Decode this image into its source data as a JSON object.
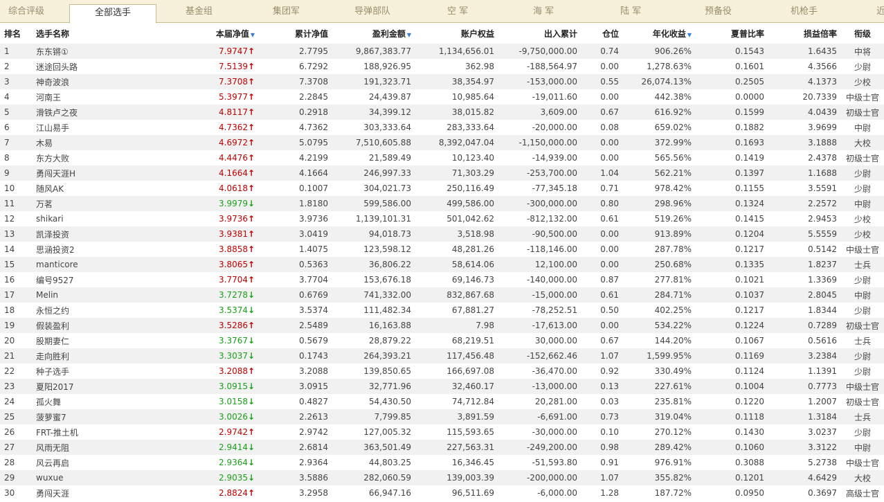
{
  "tabs": [
    {
      "label": "综合评级",
      "active": false
    },
    {
      "label": "全部选手",
      "active": true
    },
    {
      "label": "基金组",
      "active": false
    },
    {
      "label": "集团军",
      "active": false
    },
    {
      "label": "导弹部队",
      "active": false
    },
    {
      "label": "空 军",
      "active": false
    },
    {
      "label": "海 军",
      "active": false
    },
    {
      "label": "陆 军",
      "active": false
    },
    {
      "label": "预备役",
      "active": false
    },
    {
      "label": "机枪手",
      "active": false
    },
    {
      "label": "近",
      "active": false
    }
  ],
  "headers": {
    "rank": "排名",
    "name": "选手名称",
    "nav": "本届净值",
    "cum_nav": "累计净值",
    "profit": "盈利金额",
    "equity": "账户权益",
    "flow": "出入累计",
    "position": "仓位",
    "annual": "年化收益",
    "sharpe": "夏普比率",
    "pl_ratio": "损益倍率",
    "grade": "衔级"
  },
  "colors": {
    "up": "#c00000",
    "down": "#1aa01a",
    "sort_icon": "#3a7bd5"
  },
  "rows": [
    {
      "rank": "1",
      "name": "东东锵①",
      "nav": "7.9747",
      "dir": "up",
      "cum_nav": "2.7795",
      "profit": "9,867,383.77",
      "equity": "1,134,656.01",
      "flow": "-9,750,000.00",
      "position": "0.74",
      "annual": "906.26%",
      "sharpe": "0.1543",
      "pl_ratio": "1.6435",
      "grade": "中将"
    },
    {
      "rank": "2",
      "name": "迷途回头路",
      "nav": "7.5139",
      "dir": "up",
      "cum_nav": "6.7292",
      "profit": "188,926.95",
      "equity": "362.98",
      "flow": "-188,564.97",
      "position": "0.00",
      "annual": "1,278.63%",
      "sharpe": "0.1601",
      "pl_ratio": "4.3566",
      "grade": "少尉"
    },
    {
      "rank": "3",
      "name": "神奇波浪",
      "nav": "7.3708",
      "dir": "up",
      "cum_nav": "7.3708",
      "profit": "191,323.71",
      "equity": "38,354.97",
      "flow": "-153,000.00",
      "position": "0.55",
      "annual": "26,074.13%",
      "sharpe": "0.2505",
      "pl_ratio": "4.1373",
      "grade": "少校"
    },
    {
      "rank": "4",
      "name": "河南王",
      "nav": "5.3977",
      "dir": "up",
      "cum_nav": "2.2845",
      "profit": "24,439.87",
      "equity": "10,985.64",
      "flow": "-19,011.60",
      "position": "0.00",
      "annual": "442.38%",
      "sharpe": "0.0000",
      "pl_ratio": "20.7339",
      "grade": "中级士官"
    },
    {
      "rank": "5",
      "name": "滑铁卢之夜",
      "nav": "4.8117",
      "dir": "up",
      "cum_nav": "0.2918",
      "profit": "34,399.12",
      "equity": "38,015.82",
      "flow": "3,609.00",
      "position": "0.67",
      "annual": "616.92%",
      "sharpe": "0.1599",
      "pl_ratio": "4.0439",
      "grade": "初级士官"
    },
    {
      "rank": "6",
      "name": "江山易手",
      "nav": "4.7362",
      "dir": "up",
      "cum_nav": "4.7362",
      "profit": "303,333.64",
      "equity": "283,333.64",
      "flow": "-20,000.00",
      "position": "0.08",
      "annual": "659.02%",
      "sharpe": "0.1882",
      "pl_ratio": "3.9699",
      "grade": "中尉"
    },
    {
      "rank": "7",
      "name": "木易",
      "nav": "4.6972",
      "dir": "up",
      "cum_nav": "5.0795",
      "profit": "7,510,605.88",
      "equity": "8,392,047.04",
      "flow": "-1,150,000.00",
      "position": "0.00",
      "annual": "372.99%",
      "sharpe": "0.1693",
      "pl_ratio": "3.1888",
      "grade": "大校"
    },
    {
      "rank": "8",
      "name": "东方大败",
      "nav": "4.4476",
      "dir": "up",
      "cum_nav": "4.2199",
      "profit": "21,589.49",
      "equity": "10,123.40",
      "flow": "-14,939.00",
      "position": "0.00",
      "annual": "565.56%",
      "sharpe": "0.1419",
      "pl_ratio": "2.4378",
      "grade": "初级士官"
    },
    {
      "rank": "9",
      "name": "勇闯天涯H",
      "nav": "4.1664",
      "dir": "up",
      "cum_nav": "4.1664",
      "profit": "246,997.33",
      "equity": "71,303.29",
      "flow": "-253,700.00",
      "position": "1.04",
      "annual": "562.21%",
      "sharpe": "0.1397",
      "pl_ratio": "1.1688",
      "grade": "少尉"
    },
    {
      "rank": "10",
      "name": "随风AK",
      "nav": "4.0618",
      "dir": "up",
      "cum_nav": "0.1007",
      "profit": "304,021.73",
      "equity": "250,116.49",
      "flow": "-77,345.18",
      "position": "0.71",
      "annual": "978.42%",
      "sharpe": "0.1155",
      "pl_ratio": "3.5591",
      "grade": "少尉"
    },
    {
      "rank": "11",
      "name": "万茗",
      "nav": "3.9979",
      "dir": "down",
      "cum_nav": "1.8180",
      "profit": "599,586.00",
      "equity": "499,586.00",
      "flow": "-300,000.00",
      "position": "0.80",
      "annual": "298.96%",
      "sharpe": "0.1324",
      "pl_ratio": "2.2572",
      "grade": "中尉"
    },
    {
      "rank": "12",
      "name": "shikari",
      "nav": "3.9736",
      "dir": "up",
      "cum_nav": "3.9736",
      "profit": "1,139,101.31",
      "equity": "501,042.62",
      "flow": "-812,132.00",
      "position": "0.61",
      "annual": "519.26%",
      "sharpe": "0.1415",
      "pl_ratio": "2.9453",
      "grade": "少校"
    },
    {
      "rank": "13",
      "name": "凯泽投资",
      "nav": "3.9381",
      "dir": "up",
      "cum_nav": "3.0419",
      "profit": "94,018.73",
      "equity": "3,518.98",
      "flow": "-90,500.00",
      "position": "0.00",
      "annual": "913.89%",
      "sharpe": "0.1204",
      "pl_ratio": "5.5559",
      "grade": "少校"
    },
    {
      "rank": "14",
      "name": "思涵投资2",
      "nav": "3.8858",
      "dir": "up",
      "cum_nav": "1.4075",
      "profit": "123,598.12",
      "equity": "48,281.26",
      "flow": "-118,146.00",
      "position": "0.00",
      "annual": "287.78%",
      "sharpe": "0.1217",
      "pl_ratio": "0.5142",
      "grade": "中级士官"
    },
    {
      "rank": "15",
      "name": "manticore",
      "nav": "3.8065",
      "dir": "up",
      "cum_nav": "0.5363",
      "profit": "36,806.22",
      "equity": "58,614.06",
      "flow": "12,100.00",
      "position": "0.00",
      "annual": "250.68%",
      "sharpe": "0.1335",
      "pl_ratio": "1.8237",
      "grade": "士兵"
    },
    {
      "rank": "16",
      "name": "编号9527",
      "nav": "3.7704",
      "dir": "up",
      "cum_nav": "3.7704",
      "profit": "153,676.18",
      "equity": "69,146.73",
      "flow": "-140,000.00",
      "position": "0.87",
      "annual": "277.81%",
      "sharpe": "0.1021",
      "pl_ratio": "1.3369",
      "grade": "少尉"
    },
    {
      "rank": "17",
      "name": "Melin",
      "nav": "3.7278",
      "dir": "down",
      "cum_nav": "0.6769",
      "profit": "741,332.00",
      "equity": "832,867.68",
      "flow": "-15,000.00",
      "position": "0.61",
      "annual": "284.71%",
      "sharpe": "0.1037",
      "pl_ratio": "2.8045",
      "grade": "中尉"
    },
    {
      "rank": "18",
      "name": "永恒之约",
      "nav": "3.5374",
      "dir": "down",
      "cum_nav": "3.5374",
      "profit": "111,482.34",
      "equity": "67,881.27",
      "flow": "-78,252.51",
      "position": "0.50",
      "annual": "402.25%",
      "sharpe": "0.1217",
      "pl_ratio": "1.8344",
      "grade": "少尉"
    },
    {
      "rank": "19",
      "name": "假装盈利",
      "nav": "3.5286",
      "dir": "up",
      "cum_nav": "2.5489",
      "profit": "16,163.88",
      "equity": "7.98",
      "flow": "-17,613.00",
      "position": "0.00",
      "annual": "534.22%",
      "sharpe": "0.1224",
      "pl_ratio": "0.7289",
      "grade": "初级士官"
    },
    {
      "rank": "20",
      "name": "股期妻仁",
      "nav": "3.3767",
      "dir": "down",
      "cum_nav": "0.5679",
      "profit": "28,879.22",
      "equity": "68,219.51",
      "flow": "30,000.00",
      "position": "0.67",
      "annual": "144.20%",
      "sharpe": "0.1067",
      "pl_ratio": "0.5616",
      "grade": "士兵"
    },
    {
      "rank": "21",
      "name": "走向胜利",
      "nav": "3.3037",
      "dir": "down",
      "cum_nav": "0.1743",
      "profit": "264,393.21",
      "equity": "117,456.48",
      "flow": "-152,662.46",
      "position": "1.07",
      "annual": "1,599.95%",
      "sharpe": "0.1169",
      "pl_ratio": "3.2384",
      "grade": "少尉"
    },
    {
      "rank": "22",
      "name": "种子选手",
      "nav": "3.2088",
      "dir": "up",
      "cum_nav": "3.2088",
      "profit": "139,850.65",
      "equity": "166,697.08",
      "flow": "-36,470.00",
      "position": "0.92",
      "annual": "330.49%",
      "sharpe": "0.1124",
      "pl_ratio": "1.1391",
      "grade": "少尉"
    },
    {
      "rank": "23",
      "name": "夏阳2017",
      "nav": "3.0915",
      "dir": "down",
      "cum_nav": "3.0915",
      "profit": "32,771.96",
      "equity": "32,460.17",
      "flow": "-13,000.00",
      "position": "0.13",
      "annual": "227.61%",
      "sharpe": "0.1004",
      "pl_ratio": "0.7773",
      "grade": "中级士官"
    },
    {
      "rank": "24",
      "name": "孤火舞",
      "nav": "3.0158",
      "dir": "down",
      "cum_nav": "0.4827",
      "profit": "54,430.50",
      "equity": "74,712.84",
      "flow": "20,281.00",
      "position": "0.03",
      "annual": "235.81%",
      "sharpe": "0.1220",
      "pl_ratio": "1.2007",
      "grade": "初级士官"
    },
    {
      "rank": "25",
      "name": "菠萝蜜7",
      "nav": "3.0026",
      "dir": "down",
      "cum_nav": "2.2613",
      "profit": "7,799.85",
      "equity": "3,891.59",
      "flow": "-6,691.00",
      "position": "0.73",
      "annual": "319.04%",
      "sharpe": "0.1118",
      "pl_ratio": "1.3184",
      "grade": "士兵"
    },
    {
      "rank": "26",
      "name": "FRT-推土机",
      "nav": "2.9742",
      "dir": "up",
      "cum_nav": "2.9742",
      "profit": "127,005.32",
      "equity": "115,593.65",
      "flow": "-30,000.00",
      "position": "0.10",
      "annual": "270.12%",
      "sharpe": "0.1430",
      "pl_ratio": "3.0237",
      "grade": "少尉"
    },
    {
      "rank": "27",
      "name": "风雨无阻",
      "nav": "2.9414",
      "dir": "down",
      "cum_nav": "2.6814",
      "profit": "363,501.49",
      "equity": "227,563.31",
      "flow": "-249,200.00",
      "position": "0.98",
      "annual": "289.42%",
      "sharpe": "0.1060",
      "pl_ratio": "3.3122",
      "grade": "中尉"
    },
    {
      "rank": "28",
      "name": "风云再启",
      "nav": "2.9364",
      "dir": "down",
      "cum_nav": "2.9364",
      "profit": "44,803.25",
      "equity": "16,346.45",
      "flow": "-51,593.80",
      "position": "0.91",
      "annual": "976.91%",
      "sharpe": "0.3088",
      "pl_ratio": "5.2738",
      "grade": "中级士官"
    },
    {
      "rank": "29",
      "name": "wuxue",
      "nav": "2.9035",
      "dir": "down",
      "cum_nav": "3.5886",
      "profit": "282,060.59",
      "equity": "139,003.39",
      "flow": "-200,000.00",
      "position": "1.07",
      "annual": "355.82%",
      "sharpe": "0.1201",
      "pl_ratio": "4.6429",
      "grade": "大校"
    },
    {
      "rank": "30",
      "name": "勇闯天涯",
      "nav": "2.8824",
      "dir": "up",
      "cum_nav": "3.2958",
      "profit": "66,947.16",
      "equity": "96,511.69",
      "flow": "-6,000.00",
      "position": "1.28",
      "annual": "187.72%",
      "sharpe": "0.0950",
      "pl_ratio": "0.3697",
      "grade": "高级士官"
    }
  ]
}
